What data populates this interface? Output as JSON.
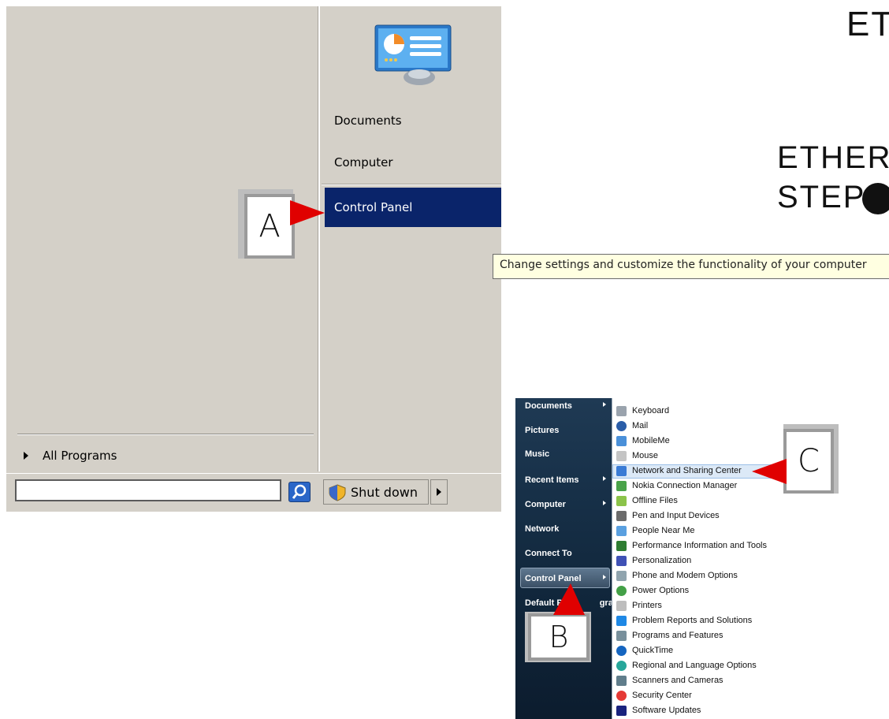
{
  "start_menu": {
    "all_programs": "All Programs",
    "shutdown_label": "Shut down",
    "right_items": [
      "Documents",
      "Computer",
      "Control Panel"
    ]
  },
  "tooltip": "Change settings and customize the functionality of your computer",
  "headings": {
    "top": "ET",
    "line1": "ETHERI",
    "line2": "STEP"
  },
  "callouts": {
    "a": "A",
    "b": "B",
    "c": "C"
  },
  "win7_menu": {
    "left_items": [
      "Documents",
      "Pictures",
      "Music",
      "Recent Items",
      "Computer",
      "Network",
      "Connect To",
      "Control Panel",
      "Default Pro",
      "grams"
    ],
    "control_panel_items": [
      "Keyboard",
      "Mail",
      "MobileMe",
      "Mouse",
      "Network and Sharing Center",
      "Nokia Connection Manager",
      "Offline Files",
      "Pen and Input Devices",
      "People Near Me",
      "Performance Information and Tools",
      "Personalization",
      "Phone and Modem Options",
      "Power Options",
      "Printers",
      "Problem Reports and Solutions",
      "Programs and Features",
      "QuickTime",
      "Regional and Language Options",
      "Scanners and Cameras",
      "Security Center",
      "Software Updates"
    ]
  },
  "colors": {
    "classic_bg": "#d4d0c8",
    "highlight": "#0a246a",
    "callout_arrow": "#e00000",
    "tooltip_bg": "#ffffe1"
  }
}
